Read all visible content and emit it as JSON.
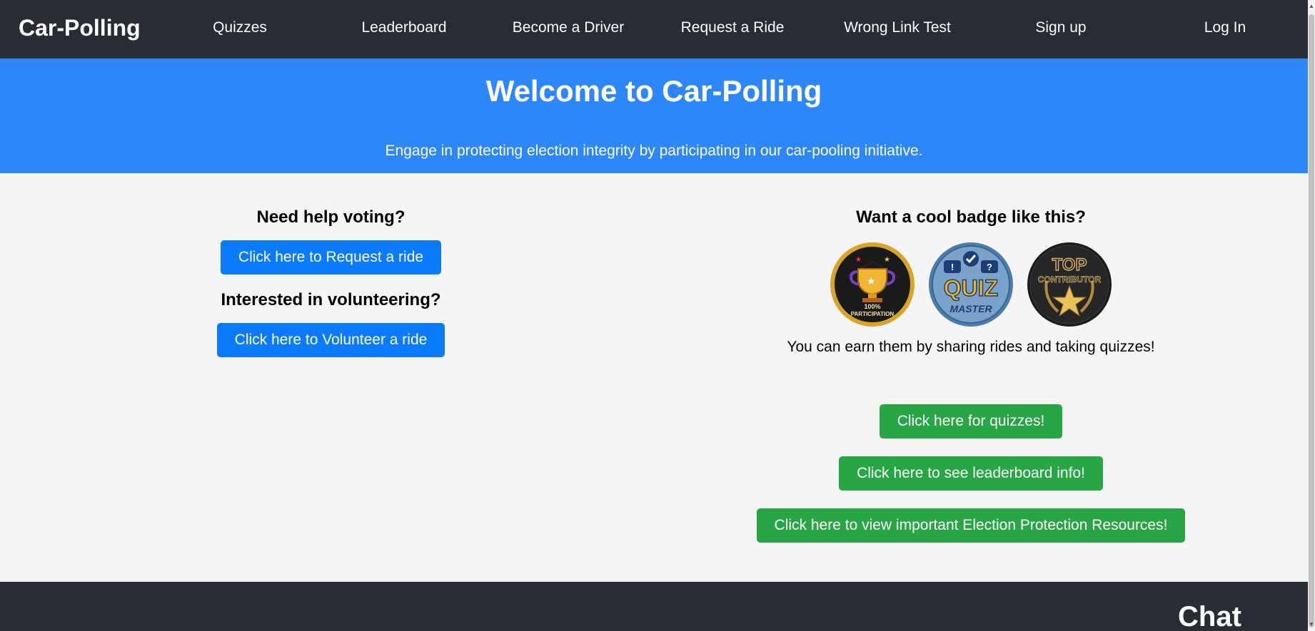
{
  "nav": {
    "brand": "Car-Polling",
    "links": [
      "Quizzes",
      "Leaderboard",
      "Become a Driver",
      "Request a Ride",
      "Wrong Link Test",
      "Sign up",
      "Log In"
    ]
  },
  "hero": {
    "title": "Welcome to Car-Polling",
    "subtitle": "Engage in protecting election integrity by participating in our car-pooling initiative."
  },
  "left": {
    "voting_heading": "Need help voting?",
    "request_button": "Click here to Request a ride",
    "volunteer_heading": "Interested in volunteering?",
    "volunteer_button": "Click here to Volunteer a ride"
  },
  "right": {
    "badge_heading": "Want a cool badge like this?",
    "badges": {
      "participation": {
        "line1": "100%",
        "line2": "PARTICIPATION"
      },
      "quiz": {
        "line1": "QUIZ",
        "line2": "MASTER"
      },
      "contributor": {
        "line1": "TOP",
        "line2": "CONTRIBUTOR"
      }
    },
    "badge_text": "You can earn them by sharing rides and taking quizzes!",
    "quizzes_button": "Click here for quizzes!",
    "leaderboard_button": "Click here to see leaderboard info!",
    "resources_button": "Click here to view important Election Protection Resources!"
  },
  "footer": {
    "chat": "Chat"
  },
  "colors": {
    "navbar": "#282c34",
    "hero": "#2d87f8",
    "primary_button": "#0a7bff",
    "success_button": "#28a545",
    "background": "#f5f5f5"
  },
  "icons": [
    "trophy-badge-icon",
    "quiz-master-badge-icon",
    "top-contributor-badge-icon"
  ]
}
